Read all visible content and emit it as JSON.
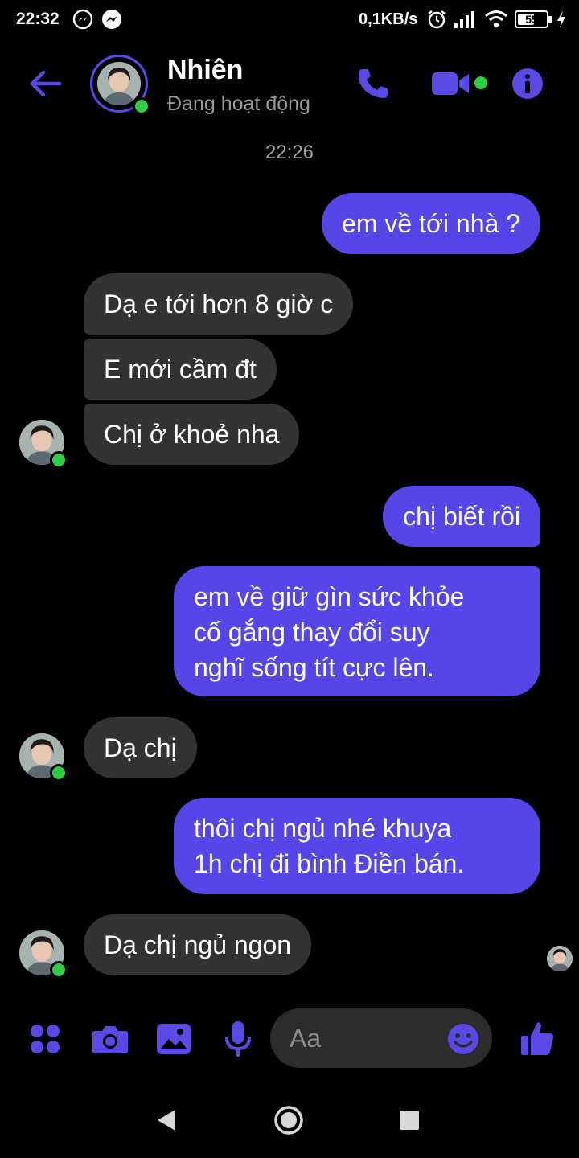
{
  "status_bar": {
    "time": "22:32",
    "network_speed": "0,1KB/s",
    "battery": "55"
  },
  "header": {
    "contact_name": "Nhiên",
    "contact_status": "Đang hoạt động"
  },
  "conversation": {
    "timestamp": "22:26",
    "messages": [
      {
        "from": "me",
        "text": "em về tới nhà ?"
      },
      {
        "from": "contact",
        "text": "Dạ e tới hơn 8 giờ c"
      },
      {
        "from": "contact",
        "text": "E mới cầm đt"
      },
      {
        "from": "contact",
        "text": "Chị ở khoẻ nha"
      },
      {
        "from": "me",
        "text": "chị biết rồi"
      },
      {
        "from": "me",
        "text": "em về giữ gìn sức khỏe\ncố gắng thay đổi suy\nnghĩ sống tít cực lên."
      },
      {
        "from": "contact",
        "text": "Dạ chị"
      },
      {
        "from": "me",
        "text": "thôi chị ngủ nhé khuya\n1h chị đi bình Điền bán."
      },
      {
        "from": "contact",
        "text": "Dạ chị ngủ ngon"
      }
    ]
  },
  "composer": {
    "placeholder": "Aa"
  },
  "colors": {
    "accent": "#5646e8",
    "incoming_bubble": "#333333",
    "online": "#31cc46",
    "background": "#000000"
  },
  "icons": {
    "back": "arrow-left-icon",
    "call": "phone-icon",
    "video": "video-camera-icon",
    "info": "info-icon",
    "more": "four-dots-icon",
    "camera": "camera-icon",
    "gallery": "image-icon",
    "voice": "microphone-icon",
    "emoji": "emoji-icon",
    "like": "thumbs-up-icon"
  }
}
